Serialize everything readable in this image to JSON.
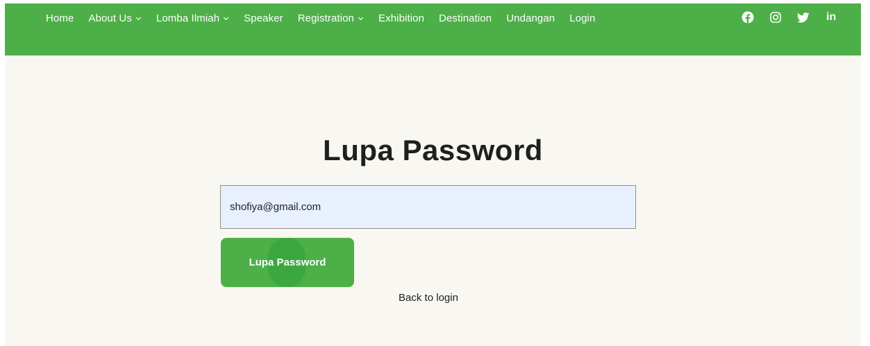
{
  "nav": {
    "items": [
      {
        "label": "Home",
        "dropdown": false
      },
      {
        "label": "About Us",
        "dropdown": true
      },
      {
        "label": "Lomba Ilmiah",
        "dropdown": true
      },
      {
        "label": "Speaker",
        "dropdown": false
      },
      {
        "label": "Registration",
        "dropdown": true
      },
      {
        "label": "Exhibition",
        "dropdown": false
      },
      {
        "label": "Destination",
        "dropdown": false
      },
      {
        "label": "Undangan",
        "dropdown": false
      },
      {
        "label": "Login",
        "dropdown": false
      }
    ]
  },
  "social": {
    "icons": [
      "facebook-icon",
      "instagram-icon",
      "twitter-icon",
      "linkedin-icon"
    ],
    "linkedin_text": "in"
  },
  "form": {
    "title": "Lupa Password",
    "email_value": "shofiya@gmail.com",
    "submit_label": "Lupa Password",
    "back_label": "Back to login"
  },
  "colors": {
    "brand_green": "#4caf48",
    "page_bg": "#f8f7f2",
    "input_bg": "#e8f0fe",
    "text_dark": "#1f1f1f"
  }
}
